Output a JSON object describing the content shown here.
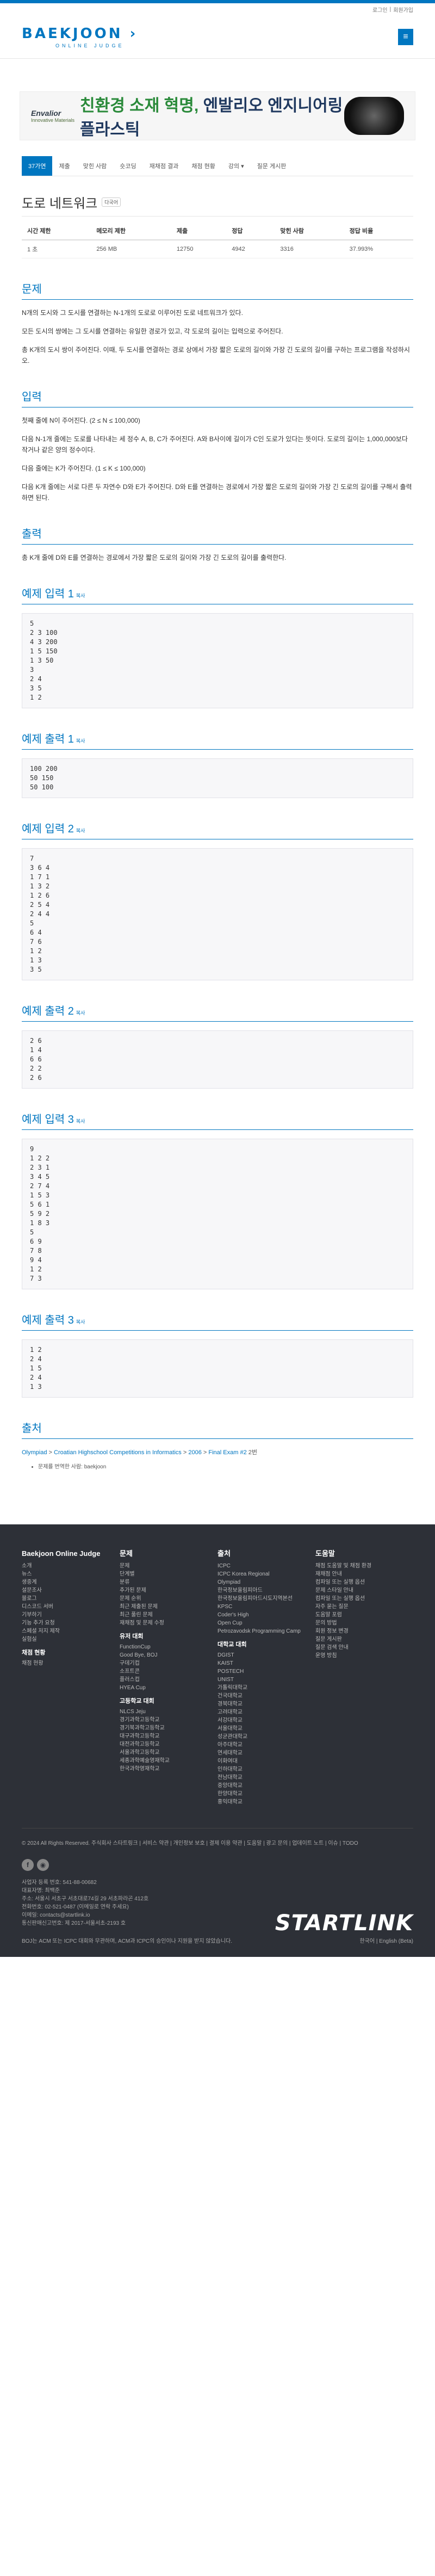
{
  "util": {
    "login": "로그인",
    "signup": "회원가입",
    "sep": "|"
  },
  "logo": {
    "main": "BAEKJOON",
    "sub": "ONLINE JUDGE",
    "arrow": "›"
  },
  "ad": {
    "brand": "Envalior",
    "brand_sub": "Innovative Materials",
    "green": "친환경 소재 혁명,",
    "rest": "엔발리오 엔지니어링 플라스틱"
  },
  "nav": [
    "37가연",
    "제출",
    "맞힌 사람",
    "숏코딩",
    "재채점 결과",
    "채점 현황",
    "강의 ▾",
    "질문 게시판"
  ],
  "problem": {
    "title": "도로 네트워크",
    "badge": "다국어",
    "headers": [
      "시간 제한",
      "메모리 제한",
      "제출",
      "정답",
      "맞힌 사람",
      "정답 비율"
    ],
    "row": [
      "1 초",
      "256 MB",
      "12750",
      "4942",
      "3316",
      "37.993%"
    ]
  },
  "sections": {
    "problem_h": "문제",
    "problem_p": [
      "N개의 도시와 그 도시를 연결하는 N-1개의 도로로 이루어진 도로 네트워크가 있다.",
      "모든 도시의 쌍에는 그 도시를 연결하는 유일한 경로가 있고, 각 도로의 길이는 입력으로 주어진다.",
      "총 K개의 도시 쌍이 주어진다. 이때, 두 도시를 연결하는 경로 상에서 가장 짧은 도로의 길이와 가장 긴 도로의 길이를 구하는 프로그램을 작성하시오."
    ],
    "input_h": "입력",
    "input_p": [
      "첫째 줄에 N이 주어진다. (2 ≤ N ≤ 100,000)",
      "다음 N-1개 줄에는 도로를 나타내는 세 정수 A, B, C가 주어진다. A와 B사이에 길이가 C인 도로가 있다는 뜻이다. 도로의 길이는 1,000,000보다 작거나 같은 양의 정수이다.",
      "다음 줄에는 K가 주어진다. (1 ≤ K ≤ 100,000)",
      "다음 K개 줄에는 서로 다른 두 자연수 D와 E가 주어진다. D와 E를 연결하는 경로에서 가장 짧은 도로의 길이와 가장 긴 도로의 길이를 구해서 출력하면 된다."
    ],
    "output_h": "출력",
    "output_p": [
      "총 K개 줄에 D와 E를 연결하는 경로에서 가장 짧은 도로의 길이와 가장 긴 도로의 길이를 출력한다."
    ],
    "copy": "복사"
  },
  "samples": [
    {
      "title": "예제 입력 1",
      "text": "5\n2 3 100\n4 3 200\n1 5 150\n1 3 50\n3\n2 4\n3 5\n1 2"
    },
    {
      "title": "예제 출력 1",
      "text": "100 200\n50 150\n50 100"
    },
    {
      "title": "예제 입력 2",
      "text": "7\n3 6 4\n1 7 1\n1 3 2\n1 2 6\n2 5 4\n2 4 4\n5\n6 4\n7 6\n1 2\n1 3\n3 5"
    },
    {
      "title": "예제 출력 2",
      "text": "2 6\n1 4\n6 6\n2 2\n2 6"
    },
    {
      "title": "예제 입력 3",
      "text": "9\n1 2 2\n2 3 1\n3 4 5\n2 7 4\n1 5 3\n5 6 1\n5 9 2\n1 8 3\n5\n6 9\n7 8\n9 4\n1 2\n7 3"
    },
    {
      "title": "예제 출력 3",
      "text": "1 2\n2 4\n1 5\n2 4\n1 3"
    }
  ],
  "source": {
    "h": "출처",
    "olympiad": "Olympiad",
    "croatian": "Croatian Highschool Competitions in Informatics",
    "year": "2006",
    "exam": "Final Exam #2",
    "num": "2번",
    "list_item": "문제를 번역한 사람: baekjoon"
  },
  "footer": {
    "col1": {
      "h": "Baekjoon Online Judge",
      "items": [
        "소개",
        "뉴스",
        "생중계",
        "설문조사",
        "블로그",
        "디스코드 서버",
        "기부하기",
        "기능 추가 요청",
        "스페셜 저지 제작",
        "실험실"
      ],
      "h2": "채점 현황",
      "items2": [
        "채점 현황"
      ]
    },
    "col2": {
      "h": "문제",
      "items": [
        "문제",
        "단계별",
        "분류",
        "추가된 문제",
        "문제 순위",
        "최근 제출된 문제",
        "최근 풀린 문제",
        "재채점 및 문제 수정"
      ],
      "h2": "유저 대회",
      "items2": [
        "FunctionCup",
        "Good Bye, BOJ",
        "구데기컵",
        "소프트콘",
        "플러스컵",
        "HYEA Cup"
      ],
      "h3": "고등학교 대회",
      "items3": [
        "NLCS Jeju",
        "경기과학고등학교",
        "경기북과학고등학교",
        "대구과학고등학교",
        "대전과학고등학교",
        "서울과학고등학교",
        "세종과학예술영재학교",
        "한국과학영재학교"
      ]
    },
    "col3": {
      "h": "출처",
      "items": [
        "ICPC",
        "ICPC Korea Regional",
        "Olympiad",
        "한국정보올림피아드",
        "한국정보올림피아드시도지역본선",
        "KPSC",
        "Coder's High",
        "Open Cup",
        "Petrozavodsk Programming Camp"
      ],
      "h2": "대학교 대회",
      "items2": [
        "DGIST",
        "KAIST",
        "POSTECH",
        "UNIST",
        "가톨릭대학교",
        "건국대학교",
        "경북대학교",
        "고려대학교",
        "서강대학교",
        "서울대학교",
        "성균관대학교",
        "아주대학교",
        "연세대학교",
        "이화여대",
        "인하대학교",
        "전남대학교",
        "중앙대학교",
        "한양대학교",
        "홍익대학교"
      ]
    },
    "col4": {
      "h": "도움말",
      "items": [
        "채점 도움말 및 채점 환경",
        "재채점 안내",
        "컴파일 또는 실행 옵션",
        "문제 스타일 안내",
        "컴파일 또는 실행 옵션",
        "자주 묻는 질문",
        "도움말 포럼",
        "문의 방법",
        "회원 정보 변경",
        "질문 게시판",
        "질문 검색 안내",
        "운영 방침"
      ]
    },
    "copyright": "© 2024 All Rights Reserved. 주식회사 스타트링크",
    "links": "| 서비스 약관 | 개인정보 보호 | 결제 이용 약관 | 도움말 | 광고 문의 | 업데이트 노트 | 이슈 | TODO",
    "company": [
      "사업자 등록 번호: 541-88-00682",
      "대표자명: 최백준",
      "주소: 서울시 서초구 서초대로74길 29 서초파라곤 412호",
      "전화번호: 02-521-0487 (이메일로 연락 주세요)",
      "이메일: contacts@startlink.io",
      "통신판매신고번호: 제 2017-서울서초-2193 호"
    ],
    "brand": "STARTLINK",
    "last": "BOJ는 ACM 또는 ICPC 대회와 무관하며, ACM과 ICPC의 승인이나 지원을 받지 않았습니다.",
    "lang": "한국어 | English (Beta)"
  }
}
